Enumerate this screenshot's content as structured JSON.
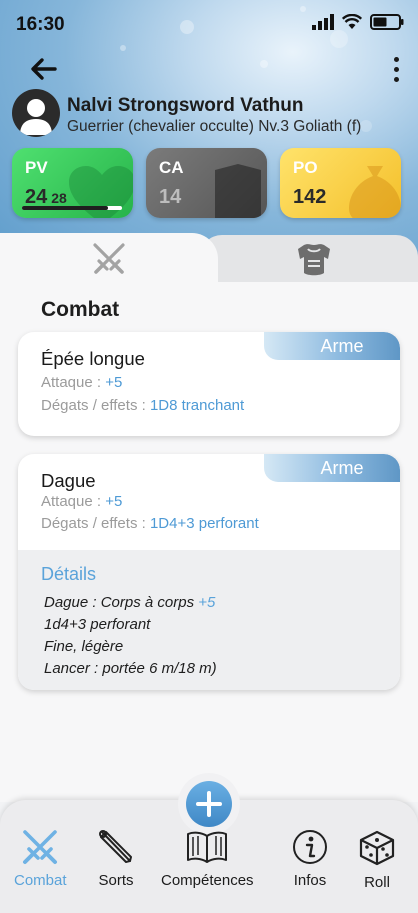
{
  "status_bar": {
    "time": "16:30"
  },
  "character": {
    "name": "Nalvi Strongsword Vathun",
    "class_line": "Guerrier (chevalier occulte) Nv.3 Goliath (f)"
  },
  "stats": {
    "pv": {
      "label": "PV",
      "current": "24",
      "max": "28",
      "fill_fraction": 0.857
    },
    "ca": {
      "label": "CA",
      "value": "14"
    },
    "po": {
      "label": "PO",
      "value": "142"
    }
  },
  "tabs": [
    {
      "name": "combat",
      "icon": "crossed-swords-icon",
      "active": true
    },
    {
      "name": "armor",
      "icon": "armor-icon",
      "active": false
    }
  ],
  "main": {
    "section_title": "Combat",
    "weapons": [
      {
        "tag": "Arme",
        "name": "Épée longue",
        "attack_label": "Attaque : ",
        "attack_value": "+5",
        "damage_label": "Dégats / effets : ",
        "damage_value": "1D8 tranchant"
      },
      {
        "tag": "Arme",
        "name": "Dague",
        "attack_label": "Attaque : ",
        "attack_value": "+5",
        "damage_label": "Dégats / effets : ",
        "damage_value": "1D4+3 perforant",
        "details": {
          "title": "Détails",
          "line1_text": "Dague : Corps à corps ",
          "line1_value": "+5",
          "line2": "1d4+3 perforant",
          "line3": "Fine, légère",
          "line4": "Lancer : portée 6 m/18 m)"
        }
      }
    ]
  },
  "bottom_nav": {
    "items": [
      {
        "label": "Combat",
        "icon": "crossed-swords-icon",
        "active": true
      },
      {
        "label": "Sorts",
        "icon": "wand-icon"
      },
      {
        "label": "Compétences",
        "icon": "book-icon"
      },
      {
        "label": "Infos",
        "icon": "info-icon"
      },
      {
        "label": "Roll",
        "icon": "dice-icon"
      }
    ]
  },
  "colors": {
    "accent": "#5aa3da",
    "pv_green": "#34c455",
    "ca_gray": "#666666",
    "po_yellow": "#f7cc3a"
  }
}
